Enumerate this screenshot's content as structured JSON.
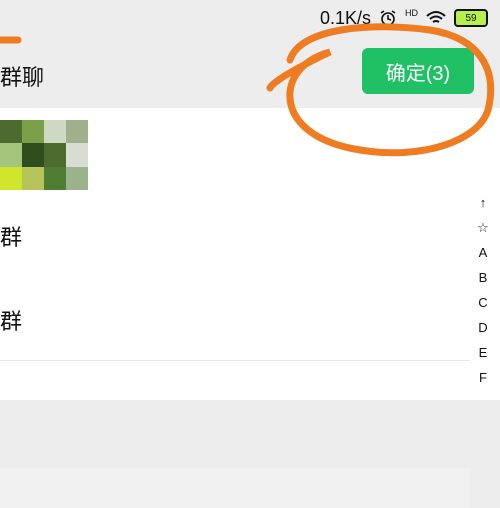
{
  "status_bar": {
    "speed": "0.1K/s",
    "hd_label": "HD",
    "battery": "59",
    "icons": [
      "alarm-icon",
      "hd-icon",
      "wifi-icon",
      "battery-icon"
    ]
  },
  "header": {
    "title": "群聊",
    "confirm_label": "确定(3)"
  },
  "list": {
    "rows": [
      {
        "label": ""
      },
      {
        "label": "群"
      },
      {
        "label": "群"
      }
    ]
  },
  "alpha_index": [
    "↑",
    "☆",
    "A",
    "B",
    "C",
    "D",
    "E",
    "F"
  ],
  "colors": {
    "accent": "#20c065",
    "annotation": "#f07c22",
    "background": "#ededed"
  }
}
